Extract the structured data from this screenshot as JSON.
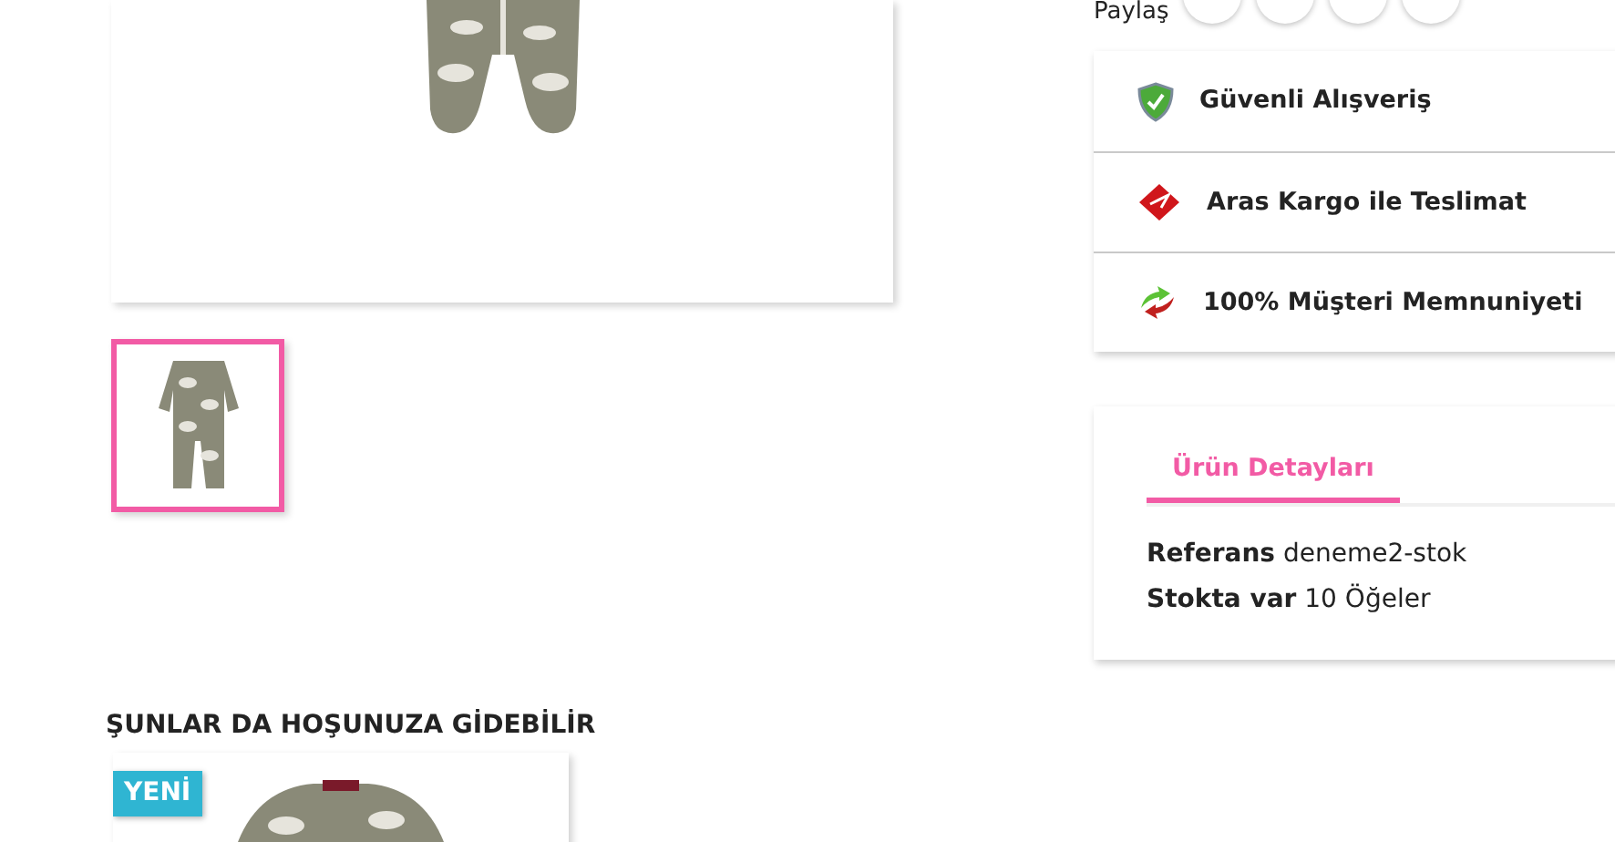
{
  "gallery": {
    "thumbnails": [
      {
        "selected": true
      }
    ]
  },
  "share": {
    "label": "Paylaş"
  },
  "reassurance": [
    {
      "kind": "shield",
      "text": "Güvenli Alışveriş"
    },
    {
      "kind": "cargo",
      "text": "Aras Kargo ile Teslimat"
    },
    {
      "kind": "arrows",
      "text": "100% Müşteri Memnuniyeti"
    }
  ],
  "tabs": [
    {
      "label": "Ürün Detayları",
      "selected": true
    }
  ],
  "details": [
    {
      "label": "Referans",
      "value": "deneme2-stok"
    },
    {
      "label": "Stokta var",
      "value": "10 Öğeler"
    }
  ],
  "related": {
    "title": "ŞUNLAR DA HOŞUNUZA GİDEBİLİR",
    "products": [
      {
        "badge": "YENİ"
      }
    ]
  }
}
